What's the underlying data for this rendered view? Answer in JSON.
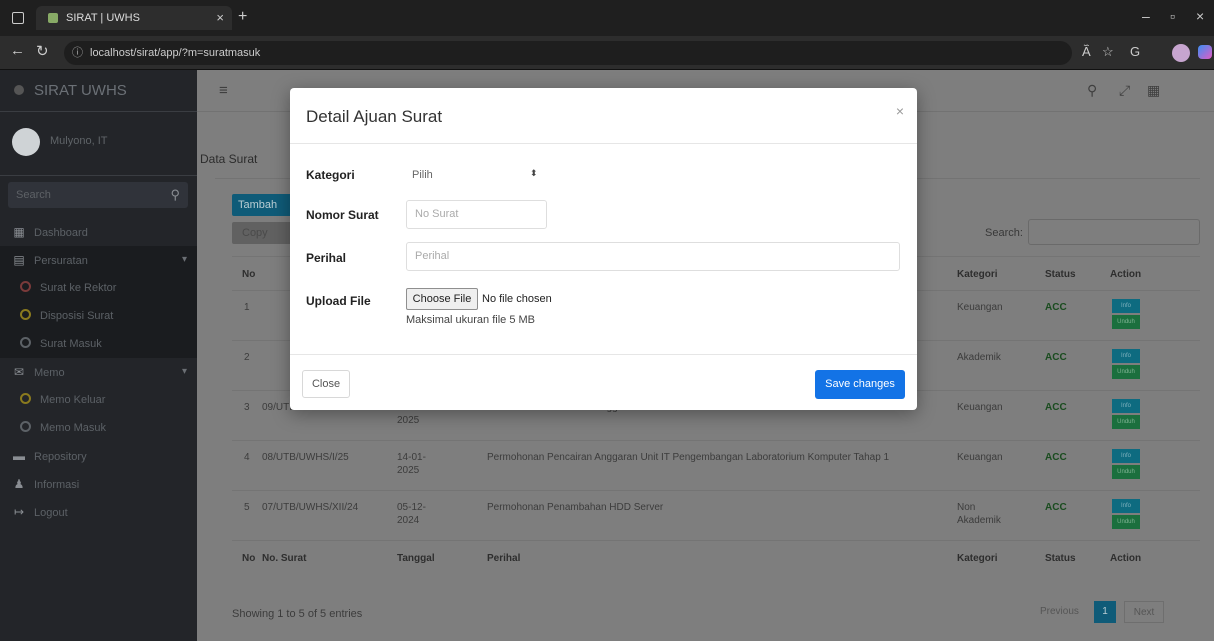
{
  "browser": {
    "tab_title": "SIRAT | UWHS",
    "tab_close": "×",
    "new_tab": "+",
    "url": "localhost/sirat/app/?m=suratmasuk",
    "read_aloud": "A᷈",
    "minimize": "–",
    "maximize": "▫",
    "close": "×"
  },
  "sidebar": {
    "brand": "SIRAT UWHS",
    "user_name": "Mulyono, IT",
    "search_placeholder": "Search",
    "items": [
      {
        "label": "Dashboard",
        "icon": "grid-icon"
      },
      {
        "label": "Persuratan",
        "icon": "file-icon",
        "chevron": "▾"
      },
      {
        "label": "Surat ke Rektor",
        "icon": "circle-red"
      },
      {
        "label": "Disposisi Surat",
        "icon": "circle-yellow"
      },
      {
        "label": "Surat Masuk",
        "icon": "circle-gray"
      },
      {
        "label": "Memo",
        "icon": "mail-icon",
        "chevron": "▾"
      },
      {
        "label": "Memo Keluar",
        "icon": "circle-yellow"
      },
      {
        "label": "Memo Masuk",
        "icon": "circle-gray"
      },
      {
        "label": "Repository",
        "icon": "archive-icon"
      },
      {
        "label": "Informasi",
        "icon": "bell-icon"
      },
      {
        "label": "Logout",
        "icon": "logout-icon"
      }
    ]
  },
  "main": {
    "section_title": "Data Surat",
    "btn_tambah": "Tambah",
    "btn_copy": "Copy",
    "search_label": "Search:",
    "columns_head": [
      "No",
      "",
      "",
      "",
      "Kategori",
      "Status",
      "Action"
    ],
    "columns_foot": [
      "No",
      "No. Surat",
      "Tanggal",
      "Perihal",
      "Kategori",
      "Status",
      "Action"
    ],
    "rows": [
      {
        "no": "1",
        "nomor": "",
        "tanggal": "",
        "perihal": "",
        "kategori": "Keuangan",
        "status": "ACC"
      },
      {
        "no": "2",
        "nomor": "",
        "tanggal": "",
        "perihal": "",
        "kategori": "Akademik",
        "status": "ACC"
      },
      {
        "no": "3",
        "nomor": "09/UTB/UWHS/I/25",
        "tanggal": "15-01-2025",
        "perihal": "Permohonan Pencairan Anggaran Unit IT Penambahan Bandwidth",
        "kategori": "Keuangan",
        "status": "ACC"
      },
      {
        "no": "4",
        "nomor": "08/UTB/UWHS/I/25",
        "tanggal": "14-01-2025",
        "perihal": "Permohonan Pencairan Anggaran Unit IT Pengembangan Laboratorium Komputer Tahap 1",
        "kategori": "Keuangan",
        "status": "ACC"
      },
      {
        "no": "5",
        "nomor": "07/UTB/UWHS/XII/24",
        "tanggal": "05-12-2024",
        "perihal": "Permohonan Penambahan HDD Server",
        "kategori": "Non Akademik",
        "status": "ACC"
      }
    ],
    "action_top": "Info",
    "action_bottom": "Unduh",
    "showing": "Showing 1 to 5 of 5 entries",
    "pager_prev": "Previous",
    "pager_cur": "1",
    "pager_next": "Next"
  },
  "modal": {
    "title": "Detail Ajuan Surat",
    "close_x": "×",
    "kategori_label": "Kategori",
    "kategori_value": "Pilih",
    "nomor_label": "Nomor Surat",
    "nomor_placeholder": "No Surat",
    "perihal_label": "Perihal",
    "perihal_placeholder": "Perihal",
    "upload_label": "Upload File",
    "choose_file": "Choose File",
    "no_file": "No file chosen",
    "hint": "Maksimal ukuran file 5 MB",
    "btn_close": "Close",
    "btn_save": "Save changes"
  }
}
